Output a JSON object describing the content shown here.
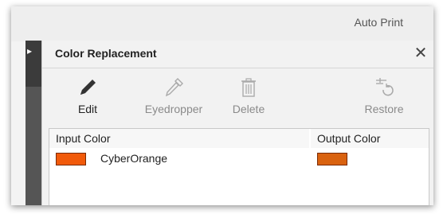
{
  "window": {
    "top_right_label": "Auto Print"
  },
  "panel": {
    "title": "Color Replacement",
    "close_glyph": "✕",
    "collapse_glyph": "▸"
  },
  "toolbar": {
    "items": [
      {
        "label": "Edit",
        "icon": "pencil-icon",
        "enabled": true
      },
      {
        "label": "Eyedropper",
        "icon": "eyedropper-icon",
        "enabled": false
      },
      {
        "label": "Delete",
        "icon": "trash-icon",
        "enabled": false
      },
      {
        "label": "Restore",
        "icon": "restore-icon",
        "enabled": false
      }
    ]
  },
  "table": {
    "headers": {
      "input": "Input Color",
      "output": "Output Color"
    },
    "rows": [
      {
        "input_name": "CyberOrange",
        "input_color": "#F15A0A",
        "output_color": "#D9620F"
      }
    ]
  },
  "colors": {
    "accent_dark": "#3b3b3b",
    "panel_bg": "#f2f2f2"
  }
}
